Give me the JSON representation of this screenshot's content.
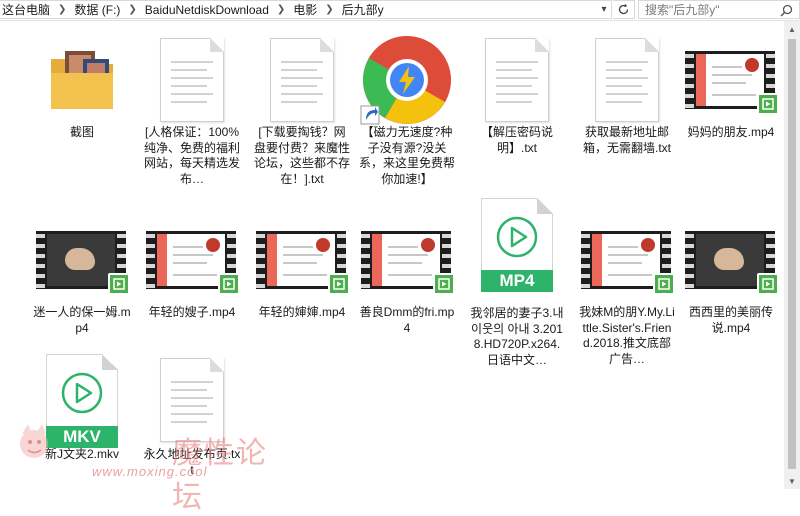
{
  "address_bar": {
    "path": [
      "这台电脑",
      "数据 (F:)",
      "BaiduNetdiskDownload",
      "电影",
      "后九部y"
    ],
    "search_placeholder": "搜索\"后九部y\""
  },
  "files": [
    {
      "name": "截图",
      "type": "folder"
    },
    {
      "name": "[人格保证：100%纯净、免费的福利网站，每天精选发布…",
      "type": "document"
    },
    {
      "name": "[下载要掏钱？网盘要付费？来魔性论坛，这些都不存在！].txt",
      "type": "document"
    },
    {
      "name": "【磁力无速度?种子没有源?没关系，来这里免费帮你加速!】",
      "type": "shortcut"
    },
    {
      "name": "【解压密码说明】.txt",
      "type": "document"
    },
    {
      "name": "获取最新地址邮箱，无需翻墙.txt",
      "type": "document"
    },
    {
      "name": "妈妈的朋友.mp4",
      "type": "video"
    },
    {
      "name": "迷一人的保一姆.mp4",
      "type": "video-dark"
    },
    {
      "name": "年轻的嫂子.mp4",
      "type": "video"
    },
    {
      "name": "年轻的婶婶.mp4",
      "type": "video"
    },
    {
      "name": "善良Dmm的fri.mp4",
      "type": "video"
    },
    {
      "name": "我邻居的妻子3.내 이웃의 아내 3.2018.HD720P.x264.日语中文…",
      "type": "mp4",
      "badge": "MP4"
    },
    {
      "name": "我妹M的朋Y.My.Little.Sister's.Friend.2018.推文底部广告…",
      "type": "video"
    },
    {
      "name": "西西里的美丽传说.mp4",
      "type": "video-dark"
    },
    {
      "name": "新J文夹2.mkv",
      "type": "mkv",
      "badge": "MKV"
    },
    {
      "name": "永久地址发布页.txt",
      "type": "document"
    }
  ],
  "watermark": {
    "title": "魔性论坛",
    "url": "www.moxing.cool"
  },
  "colors": {
    "media_green": "#2db36a",
    "badge_green": "#4cae4c",
    "folder_yellow": "#f2c14e"
  }
}
